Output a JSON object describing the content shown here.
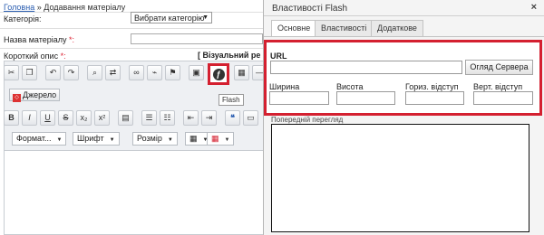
{
  "breadcrumb": {
    "home": "Головна",
    "separator": "»",
    "current": "Додавання матеріалу"
  },
  "form": {
    "category_label": "Категорія:",
    "category_select": "Вибрати категорію",
    "title_label": "Назва матеріалу",
    "required_mark": "*:",
    "short_desc_label": "Короткий опис",
    "visual_toggle": "[ Візуальний ре"
  },
  "editor": {
    "source_button": "Джерело",
    "flash_tooltip": "Flash",
    "toolbar_row1": [
      "cut-icon",
      "copy-icon",
      "undo-icon",
      "redo-icon",
      "find-icon",
      "replace-icon",
      "link-icon",
      "unlink-icon",
      "anchor-icon",
      "image-icon"
    ],
    "toolbar_row3": [
      "B",
      "I",
      "U",
      "S",
      "x₂",
      "x²"
    ],
    "combos": [
      "Формат...",
      "Шрифт",
      "Розмір"
    ]
  },
  "dialog": {
    "title": "Властивості Flash",
    "close": "×",
    "tabs": [
      "Основне",
      "Властивості",
      "Додаткове"
    ],
    "url_label": "URL",
    "browse_button": "Огляд Сервера",
    "width_label": "Ширина",
    "height_label": "Висота",
    "hspace_label": "Гориз. відступ",
    "vspace_label": "Верт. відступ",
    "preview_label": "Попередній перегляд"
  },
  "colors": {
    "highlight": "#d42030",
    "link": "#2a5db0"
  }
}
